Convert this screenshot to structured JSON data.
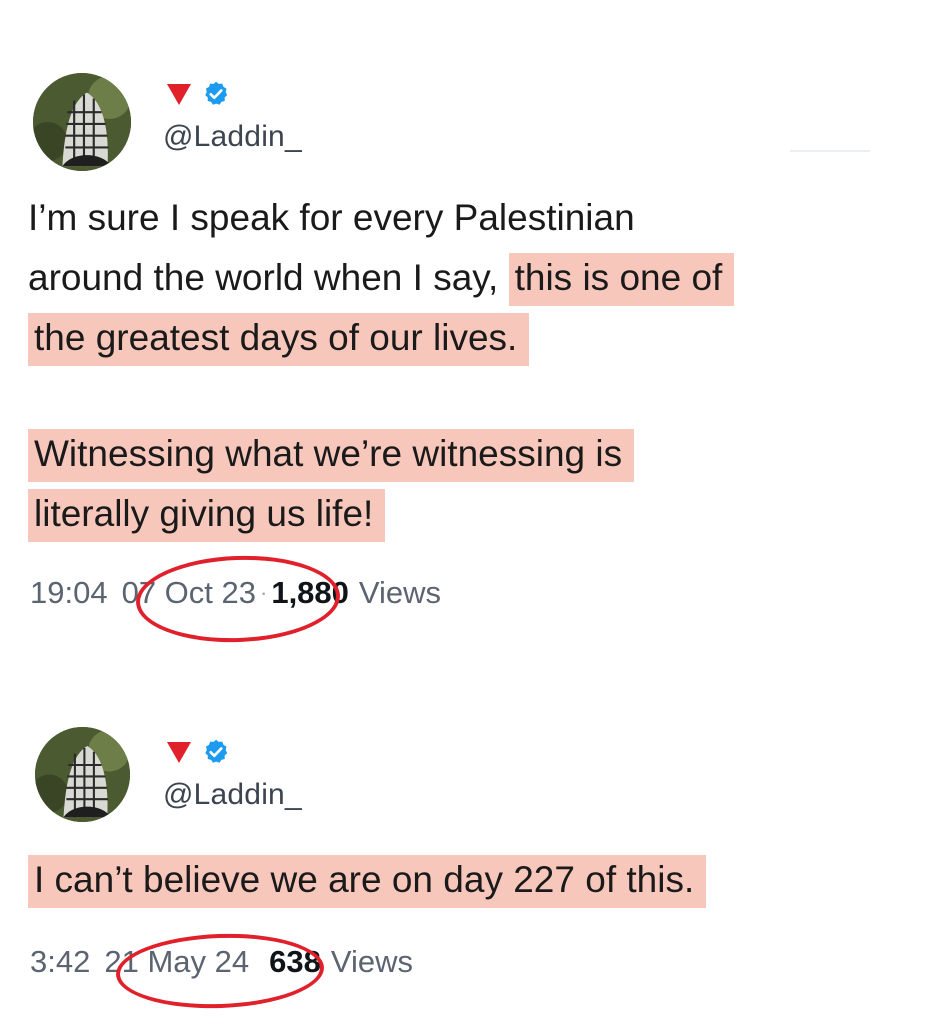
{
  "tweets": [
    {
      "handle": "@Laddin_",
      "paragraph1_plain": "I’m sure I speak for every Palestinian",
      "paragraph1_line2_plain": "around the world when I say,",
      "paragraph1_line2_highlight": "this is one of",
      "paragraph1_line3_highlight": "the greatest days of our lives.",
      "paragraph2_line1_highlight": "Witnessing what we’re witnessing is",
      "paragraph2_line2_highlight": "literally giving us life!",
      "time": "19:04",
      "date": "07 Oct 23",
      "views_count": "1,880",
      "views_label": "Views"
    },
    {
      "handle": "@Laddin_",
      "paragraph1_highlight": "I can’t believe we are on day 227 of this.",
      "time": "3:42",
      "date": "21 May 24",
      "views_count": "638",
      "views_label": "Views"
    }
  ],
  "colors": {
    "highlight": "#f8c7bb",
    "annotation_circle": "#e0202b",
    "verified_badge": "#1d9bf0",
    "red_triangle": "#e0202b"
  },
  "icons": [
    "red-triangle-icon",
    "verified-badge-icon"
  ]
}
